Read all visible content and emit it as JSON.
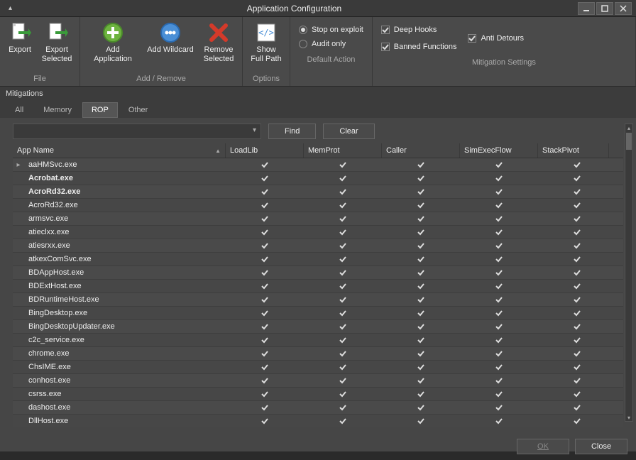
{
  "window": {
    "title": "Application Configuration"
  },
  "ribbon": {
    "groups": {
      "file": {
        "label": "File",
        "export": "Export",
        "export_selected": "Export Selected"
      },
      "add_remove": {
        "label": "Add / Remove",
        "add_app": "Add Application",
        "add_wildcard": "Add Wildcard",
        "remove_selected": "Remove Selected"
      },
      "options": {
        "label": "Options",
        "show_full_path": "Show Full Path"
      },
      "default_action": {
        "label": "Default Action",
        "stop_on_exploit": "Stop on exploit",
        "audit_only": "Audit only",
        "selected": "stop"
      },
      "mitigation": {
        "label": "Mitigation Settings",
        "deep_hooks": "Deep Hooks",
        "anti_detours": "Anti Detours",
        "banned_functions": "Banned Functions"
      }
    }
  },
  "section_label": "Mitigations",
  "tabs": {
    "items": [
      "All",
      "Memory",
      "ROP",
      "Other"
    ],
    "active": 2
  },
  "search": {
    "find": "Find",
    "clear": "Clear"
  },
  "grid": {
    "columns": [
      "App Name",
      "LoadLib",
      "MemProt",
      "Caller",
      "SimExecFlow",
      "StackPivot"
    ],
    "rows": [
      {
        "name": "aaHMSvc.exe",
        "bold": false,
        "marker": true,
        "checks": [
          true,
          true,
          true,
          true,
          true
        ]
      },
      {
        "name": "Acrobat.exe",
        "bold": true,
        "checks": [
          true,
          true,
          true,
          true,
          true
        ]
      },
      {
        "name": "AcroRd32.exe",
        "bold": true,
        "checks": [
          true,
          true,
          true,
          true,
          true
        ]
      },
      {
        "name": "AcroRd32.exe",
        "bold": false,
        "checks": [
          true,
          true,
          true,
          true,
          true
        ]
      },
      {
        "name": "armsvc.exe",
        "bold": false,
        "checks": [
          true,
          true,
          true,
          true,
          true
        ]
      },
      {
        "name": "atieclxx.exe",
        "bold": false,
        "checks": [
          true,
          true,
          true,
          true,
          true
        ]
      },
      {
        "name": "atiesrxx.exe",
        "bold": false,
        "checks": [
          true,
          true,
          true,
          true,
          true
        ]
      },
      {
        "name": "atkexComSvc.exe",
        "bold": false,
        "checks": [
          true,
          true,
          true,
          true,
          true
        ]
      },
      {
        "name": "BDAppHost.exe",
        "bold": false,
        "checks": [
          true,
          true,
          true,
          true,
          true
        ]
      },
      {
        "name": "BDExtHost.exe",
        "bold": false,
        "checks": [
          true,
          true,
          true,
          true,
          true
        ]
      },
      {
        "name": "BDRuntimeHost.exe",
        "bold": false,
        "checks": [
          true,
          true,
          true,
          true,
          true
        ]
      },
      {
        "name": "BingDesktop.exe",
        "bold": false,
        "checks": [
          true,
          true,
          true,
          true,
          true
        ]
      },
      {
        "name": "BingDesktopUpdater.exe",
        "bold": false,
        "checks": [
          true,
          true,
          true,
          true,
          true
        ]
      },
      {
        "name": "c2c_service.exe",
        "bold": false,
        "checks": [
          true,
          true,
          true,
          true,
          true
        ]
      },
      {
        "name": "chrome.exe",
        "bold": false,
        "checks": [
          true,
          true,
          true,
          true,
          true
        ]
      },
      {
        "name": "ChsIME.exe",
        "bold": false,
        "checks": [
          true,
          true,
          true,
          true,
          true
        ]
      },
      {
        "name": "conhost.exe",
        "bold": false,
        "checks": [
          true,
          true,
          true,
          true,
          true
        ]
      },
      {
        "name": "csrss.exe",
        "bold": false,
        "checks": [
          true,
          true,
          true,
          true,
          true
        ]
      },
      {
        "name": "dashost.exe",
        "bold": false,
        "checks": [
          true,
          true,
          true,
          true,
          true
        ]
      },
      {
        "name": "DllHost.exe",
        "bold": false,
        "checks": [
          true,
          true,
          true,
          true,
          true
        ]
      }
    ]
  },
  "footer": {
    "ok": "OK",
    "close": "Close"
  }
}
